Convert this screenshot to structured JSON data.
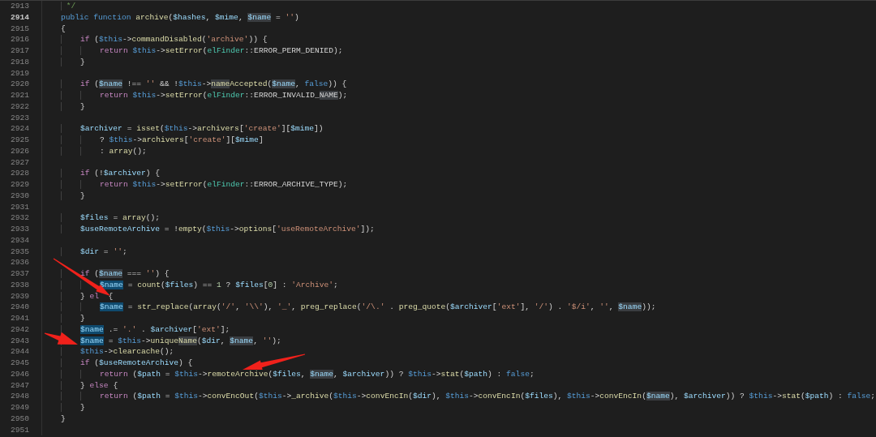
{
  "editor": {
    "lines": [
      {
        "number": "2913",
        "current": false,
        "tokens": [
          {
            "kind": "com",
            "text": "     */"
          }
        ]
      },
      {
        "number": "2914",
        "current": true,
        "tokens": [
          {
            "kind": "kw",
            "text": "    public "
          },
          {
            "kind": "kw",
            "text": "function "
          },
          {
            "kind": "fn",
            "text": "archive"
          },
          {
            "kind": "pl",
            "text": "("
          },
          {
            "kind": "var",
            "text": "$hashes"
          },
          {
            "kind": "pl",
            "text": ", "
          },
          {
            "kind": "var",
            "text": "$mime"
          },
          {
            "kind": "pl",
            "text": ", "
          },
          {
            "kind": "hit_var",
            "text": "$name"
          },
          {
            "kind": "pl",
            "text": " = "
          },
          {
            "kind": "str",
            "text": "''"
          },
          {
            "kind": "pl",
            "text": ")"
          }
        ]
      },
      {
        "number": "2915",
        "current": false,
        "tokens": [
          {
            "kind": "pl",
            "text": "    {"
          }
        ]
      },
      {
        "number": "2916",
        "current": false,
        "tokens": [
          {
            "kind": "ctl",
            "text": "        if"
          },
          {
            "kind": "pl",
            "text": " ("
          },
          {
            "kind": "this",
            "text": "$this"
          },
          {
            "kind": "pl",
            "text": "->"
          },
          {
            "kind": "fn",
            "text": "commandDisabled"
          },
          {
            "kind": "pl",
            "text": "("
          },
          {
            "kind": "str",
            "text": "'archive'"
          },
          {
            "kind": "pl",
            "text": ")) {"
          }
        ]
      },
      {
        "number": "2917",
        "current": false,
        "tokens": [
          {
            "kind": "ctl",
            "text": "            return "
          },
          {
            "kind": "this",
            "text": "$this"
          },
          {
            "kind": "pl",
            "text": "->"
          },
          {
            "kind": "fn",
            "text": "setError"
          },
          {
            "kind": "pl",
            "text": "("
          },
          {
            "kind": "cls",
            "text": "elFinder"
          },
          {
            "kind": "pl",
            "text": "::ERROR_PERM_DENIED);"
          }
        ]
      },
      {
        "number": "2918",
        "current": false,
        "tokens": [
          {
            "kind": "pl",
            "text": "        }"
          }
        ]
      },
      {
        "number": "2919",
        "current": false
      },
      {
        "number": "2920",
        "current": false,
        "tokens": [
          {
            "kind": "ctl",
            "text": "        if"
          },
          {
            "kind": "pl",
            "text": " ("
          },
          {
            "kind": "hit_var",
            "text": "$name"
          },
          {
            "kind": "pl",
            "text": " !== "
          },
          {
            "kind": "str",
            "text": "''"
          },
          {
            "kind": "pl",
            "text": " && !"
          },
          {
            "kind": "this",
            "text": "$this"
          },
          {
            "kind": "pl",
            "text": "->"
          },
          {
            "kind": "hit_fn",
            "text": "name"
          },
          {
            "kind": "fn",
            "text": "Accepted"
          },
          {
            "kind": "pl",
            "text": "("
          },
          {
            "kind": "hit_var",
            "text": "$name"
          },
          {
            "kind": "pl",
            "text": ", "
          },
          {
            "kind": "kw",
            "text": "false"
          },
          {
            "kind": "pl",
            "text": ")) {"
          }
        ]
      },
      {
        "number": "2921",
        "current": false,
        "tokens": [
          {
            "kind": "ctl",
            "text": "            return "
          },
          {
            "kind": "this",
            "text": "$this"
          },
          {
            "kind": "pl",
            "text": "->"
          },
          {
            "kind": "fn",
            "text": "setError"
          },
          {
            "kind": "pl",
            "text": "("
          },
          {
            "kind": "cls",
            "text": "elFinder"
          },
          {
            "kind": "pl",
            "text": "::ERROR_INVALID_"
          },
          {
            "kind": "hit_pl",
            "text": "NAME"
          },
          {
            "kind": "pl",
            "text": ");"
          }
        ]
      },
      {
        "number": "2922",
        "current": false,
        "tokens": [
          {
            "kind": "pl",
            "text": "        }"
          }
        ]
      },
      {
        "number": "2923",
        "current": false
      },
      {
        "number": "2924",
        "current": false,
        "tokens": [
          {
            "kind": "var",
            "text": "        $archiver"
          },
          {
            "kind": "pl",
            "text": " = "
          },
          {
            "kind": "fn",
            "text": "isset"
          },
          {
            "kind": "pl",
            "text": "("
          },
          {
            "kind": "this",
            "text": "$this"
          },
          {
            "kind": "pl",
            "text": "->"
          },
          {
            "kind": "fn",
            "text": "archivers"
          },
          {
            "kind": "pl",
            "text": "["
          },
          {
            "kind": "str",
            "text": "'create'"
          },
          {
            "kind": "pl",
            "text": "]["
          },
          {
            "kind": "var",
            "text": "$mime"
          },
          {
            "kind": "pl",
            "text": "])"
          }
        ]
      },
      {
        "number": "2925",
        "current": false,
        "tokens": [
          {
            "kind": "pl",
            "text": "            ? "
          },
          {
            "kind": "this",
            "text": "$this"
          },
          {
            "kind": "pl",
            "text": "->"
          },
          {
            "kind": "fn",
            "text": "archivers"
          },
          {
            "kind": "pl",
            "text": "["
          },
          {
            "kind": "str",
            "text": "'create'"
          },
          {
            "kind": "pl",
            "text": "]["
          },
          {
            "kind": "var",
            "text": "$mime"
          },
          {
            "kind": "pl",
            "text": "]"
          }
        ]
      },
      {
        "number": "2926",
        "current": false,
        "tokens": [
          {
            "kind": "pl",
            "text": "            : "
          },
          {
            "kind": "fn",
            "text": "array"
          },
          {
            "kind": "pl",
            "text": "();"
          }
        ]
      },
      {
        "number": "2927",
        "current": false
      },
      {
        "number": "2928",
        "current": false,
        "tokens": [
          {
            "kind": "ctl",
            "text": "        if"
          },
          {
            "kind": "pl",
            "text": " (!"
          },
          {
            "kind": "var",
            "text": "$archiver"
          },
          {
            "kind": "pl",
            "text": ") {"
          }
        ]
      },
      {
        "number": "2929",
        "current": false,
        "tokens": [
          {
            "kind": "ctl",
            "text": "            return "
          },
          {
            "kind": "this",
            "text": "$this"
          },
          {
            "kind": "pl",
            "text": "->"
          },
          {
            "kind": "fn",
            "text": "setError"
          },
          {
            "kind": "pl",
            "text": "("
          },
          {
            "kind": "cls",
            "text": "elFinder"
          },
          {
            "kind": "pl",
            "text": "::ERROR_ARCHIVE_TYPE);"
          }
        ]
      },
      {
        "number": "2930",
        "current": false,
        "tokens": [
          {
            "kind": "pl",
            "text": "        }"
          }
        ]
      },
      {
        "number": "2931",
        "current": false
      },
      {
        "number": "2932",
        "current": false,
        "tokens": [
          {
            "kind": "var",
            "text": "        $files"
          },
          {
            "kind": "pl",
            "text": " = "
          },
          {
            "kind": "fn",
            "text": "array"
          },
          {
            "kind": "pl",
            "text": "();"
          }
        ]
      },
      {
        "number": "2933",
        "current": false,
        "tokens": [
          {
            "kind": "var",
            "text": "        $useRemoteArchive"
          },
          {
            "kind": "pl",
            "text": " = !"
          },
          {
            "kind": "fn",
            "text": "empty"
          },
          {
            "kind": "pl",
            "text": "("
          },
          {
            "kind": "this",
            "text": "$this"
          },
          {
            "kind": "pl",
            "text": "->"
          },
          {
            "kind": "fn",
            "text": "options"
          },
          {
            "kind": "pl",
            "text": "["
          },
          {
            "kind": "str",
            "text": "'useRemoteArchive'"
          },
          {
            "kind": "pl",
            "text": "]);"
          }
        ]
      },
      {
        "number": "2934",
        "current": false
      },
      {
        "number": "2935",
        "current": false,
        "tokens": [
          {
            "kind": "var",
            "text": "        $dir"
          },
          {
            "kind": "pl",
            "text": " = "
          },
          {
            "kind": "str",
            "text": "''"
          },
          {
            "kind": "pl",
            "text": ";"
          }
        ]
      },
      {
        "number": "2936",
        "current": false
      },
      {
        "number": "2937",
        "current": false,
        "tokens": [
          {
            "kind": "ctl",
            "text": "        if"
          },
          {
            "kind": "pl",
            "text": " ("
          },
          {
            "kind": "hit_var",
            "text": "$name"
          },
          {
            "kind": "pl",
            "text": " === "
          },
          {
            "kind": "str",
            "text": "''"
          },
          {
            "kind": "pl",
            "text": ") {"
          }
        ]
      },
      {
        "number": "2938",
        "current": false,
        "tokens": [
          {
            "kind": "sel_var",
            "text": "            $name"
          },
          {
            "kind": "pl",
            "text": " = "
          },
          {
            "kind": "fn",
            "text": "count"
          },
          {
            "kind": "pl",
            "text": "("
          },
          {
            "kind": "var",
            "text": "$files"
          },
          {
            "kind": "pl",
            "text": ") == "
          },
          {
            "kind": "num",
            "text": "1"
          },
          {
            "kind": "pl",
            "text": " ? "
          },
          {
            "kind": "var",
            "text": "$files"
          },
          {
            "kind": "pl",
            "text": "["
          },
          {
            "kind": "num",
            "text": "0"
          },
          {
            "kind": "pl",
            "text": "] : "
          },
          {
            "kind": "str",
            "text": "'Archive'"
          },
          {
            "kind": "pl",
            "text": ";"
          }
        ]
      },
      {
        "number": "2939",
        "current": false,
        "tokens": [
          {
            "kind": "pl",
            "text": "        } "
          },
          {
            "kind": "ctl",
            "text": "el"
          },
          {
            "kind": "pl",
            "text": "  {"
          }
        ]
      },
      {
        "number": "2940",
        "current": false,
        "tokens": [
          {
            "kind": "sel_var",
            "text": "            $name"
          },
          {
            "kind": "pl",
            "text": " = "
          },
          {
            "kind": "fn",
            "text": "str_replace"
          },
          {
            "kind": "pl",
            "text": "("
          },
          {
            "kind": "fn",
            "text": "array"
          },
          {
            "kind": "pl",
            "text": "("
          },
          {
            "kind": "str",
            "text": "'/'"
          },
          {
            "kind": "pl",
            "text": ", "
          },
          {
            "kind": "str",
            "text": "'\\\\'"
          },
          {
            "kind": "pl",
            "text": "), "
          },
          {
            "kind": "str",
            "text": "'_'"
          },
          {
            "kind": "pl",
            "text": ", "
          },
          {
            "kind": "fn",
            "text": "preg_replace"
          },
          {
            "kind": "pl",
            "text": "("
          },
          {
            "kind": "str",
            "text": "'/\\.'"
          },
          {
            "kind": "pl",
            "text": " . "
          },
          {
            "kind": "fn",
            "text": "preg_quote"
          },
          {
            "kind": "pl",
            "text": "("
          },
          {
            "kind": "var",
            "text": "$archiver"
          },
          {
            "kind": "pl",
            "text": "["
          },
          {
            "kind": "str",
            "text": "'ext'"
          },
          {
            "kind": "pl",
            "text": "], "
          },
          {
            "kind": "str",
            "text": "'/'"
          },
          {
            "kind": "pl",
            "text": ") . "
          },
          {
            "kind": "str",
            "text": "'$/i'"
          },
          {
            "kind": "pl",
            "text": ", "
          },
          {
            "kind": "str",
            "text": "''"
          },
          {
            "kind": "pl",
            "text": ", "
          },
          {
            "kind": "hit_var",
            "text": "$name"
          },
          {
            "kind": "pl",
            "text": "));"
          }
        ]
      },
      {
        "number": "2941",
        "current": false,
        "tokens": [
          {
            "kind": "pl",
            "text": "        }"
          }
        ]
      },
      {
        "number": "2942",
        "current": false,
        "tokens": [
          {
            "kind": "sel_var",
            "text": "        $name"
          },
          {
            "kind": "pl",
            "text": " .= "
          },
          {
            "kind": "str",
            "text": "'.'"
          },
          {
            "kind": "pl",
            "text": " . "
          },
          {
            "kind": "var",
            "text": "$archiver"
          },
          {
            "kind": "pl",
            "text": "["
          },
          {
            "kind": "str",
            "text": "'ext'"
          },
          {
            "kind": "pl",
            "text": "];"
          }
        ]
      },
      {
        "number": "2943",
        "current": false,
        "tokens": [
          {
            "kind": "sel_var",
            "text": "        $name"
          },
          {
            "kind": "pl",
            "text": " = "
          },
          {
            "kind": "this",
            "text": "$this"
          },
          {
            "kind": "pl",
            "text": "->"
          },
          {
            "kind": "fn",
            "text": "unique"
          },
          {
            "kind": "hit_fn",
            "text": "Name"
          },
          {
            "kind": "pl",
            "text": "("
          },
          {
            "kind": "var",
            "text": "$dir"
          },
          {
            "kind": "pl",
            "text": ", "
          },
          {
            "kind": "hit_var",
            "text": "$name"
          },
          {
            "kind": "pl",
            "text": ", "
          },
          {
            "kind": "str",
            "text": "''"
          },
          {
            "kind": "pl",
            "text": ");"
          }
        ]
      },
      {
        "number": "2944",
        "current": false,
        "tokens": [
          {
            "kind": "this",
            "text": "        $this"
          },
          {
            "kind": "pl",
            "text": "->"
          },
          {
            "kind": "fn",
            "text": "clearcache"
          },
          {
            "kind": "pl",
            "text": "();"
          }
        ]
      },
      {
        "number": "2945",
        "current": false,
        "tokens": [
          {
            "kind": "ctl",
            "text": "        if"
          },
          {
            "kind": "pl",
            "text": " ("
          },
          {
            "kind": "var",
            "text": "$useRemoteArchive"
          },
          {
            "kind": "pl",
            "text": ") {"
          }
        ]
      },
      {
        "number": "2946",
        "current": false,
        "tokens": [
          {
            "kind": "ctl",
            "text": "            return"
          },
          {
            "kind": "pl",
            "text": " ("
          },
          {
            "kind": "var",
            "text": "$path"
          },
          {
            "kind": "pl",
            "text": " = "
          },
          {
            "kind": "this",
            "text": "$this"
          },
          {
            "kind": "pl",
            "text": "->"
          },
          {
            "kind": "fn",
            "text": "remoteArchive"
          },
          {
            "kind": "pl",
            "text": "("
          },
          {
            "kind": "var",
            "text": "$files"
          },
          {
            "kind": "pl",
            "text": ", "
          },
          {
            "kind": "hit_var",
            "text": "$name"
          },
          {
            "kind": "pl",
            "text": ", "
          },
          {
            "kind": "var",
            "text": "$archiver"
          },
          {
            "kind": "pl",
            "text": ")) ? "
          },
          {
            "kind": "this",
            "text": "$this"
          },
          {
            "kind": "pl",
            "text": "->"
          },
          {
            "kind": "fn",
            "text": "stat"
          },
          {
            "kind": "pl",
            "text": "("
          },
          {
            "kind": "var",
            "text": "$path"
          },
          {
            "kind": "pl",
            "text": ") : "
          },
          {
            "kind": "kw",
            "text": "false"
          },
          {
            "kind": "pl",
            "text": ";"
          }
        ]
      },
      {
        "number": "2947",
        "current": false,
        "tokens": [
          {
            "kind": "pl",
            "text": "        } "
          },
          {
            "kind": "ctl",
            "text": "else"
          },
          {
            "kind": "pl",
            "text": " {"
          }
        ]
      },
      {
        "number": "2948",
        "current": false,
        "tokens": [
          {
            "kind": "ctl",
            "text": "            return"
          },
          {
            "kind": "pl",
            "text": " ("
          },
          {
            "kind": "var",
            "text": "$path"
          },
          {
            "kind": "pl",
            "text": " = "
          },
          {
            "kind": "this",
            "text": "$this"
          },
          {
            "kind": "pl",
            "text": "->"
          },
          {
            "kind": "fn",
            "text": "convEncOut"
          },
          {
            "kind": "pl",
            "text": "("
          },
          {
            "kind": "this",
            "text": "$this"
          },
          {
            "kind": "pl",
            "text": "->"
          },
          {
            "kind": "fn",
            "text": "_archive"
          },
          {
            "kind": "pl",
            "text": "("
          },
          {
            "kind": "this",
            "text": "$this"
          },
          {
            "kind": "pl",
            "text": "->"
          },
          {
            "kind": "fn",
            "text": "convEncIn"
          },
          {
            "kind": "pl",
            "text": "("
          },
          {
            "kind": "var",
            "text": "$dir"
          },
          {
            "kind": "pl",
            "text": "), "
          },
          {
            "kind": "this",
            "text": "$this"
          },
          {
            "kind": "pl",
            "text": "->"
          },
          {
            "kind": "fn",
            "text": "convEncIn"
          },
          {
            "kind": "pl",
            "text": "("
          },
          {
            "kind": "var",
            "text": "$files"
          },
          {
            "kind": "pl",
            "text": "), "
          },
          {
            "kind": "this",
            "text": "$this"
          },
          {
            "kind": "pl",
            "text": "->"
          },
          {
            "kind": "fn",
            "text": "convEncIn"
          },
          {
            "kind": "pl",
            "text": "("
          },
          {
            "kind": "hit_var",
            "text": "$name"
          },
          {
            "kind": "pl",
            "text": "), "
          },
          {
            "kind": "var",
            "text": "$archiver"
          },
          {
            "kind": "pl",
            "text": ")) ? "
          },
          {
            "kind": "this",
            "text": "$this"
          },
          {
            "kind": "pl",
            "text": "->"
          },
          {
            "kind": "fn",
            "text": "stat"
          },
          {
            "kind": "pl",
            "text": "("
          },
          {
            "kind": "var",
            "text": "$path"
          },
          {
            "kind": "pl",
            "text": ") : "
          },
          {
            "kind": "kw",
            "text": "false"
          },
          {
            "kind": "pl",
            "text": ";"
          }
        ]
      },
      {
        "number": "2949",
        "current": false,
        "tokens": [
          {
            "kind": "pl",
            "text": "        }"
          }
        ]
      },
      {
        "number": "2950",
        "current": false,
        "tokens": [
          {
            "kind": "pl",
            "text": "    }"
          }
        ]
      },
      {
        "number": "2951",
        "current": false
      }
    ]
  }
}
